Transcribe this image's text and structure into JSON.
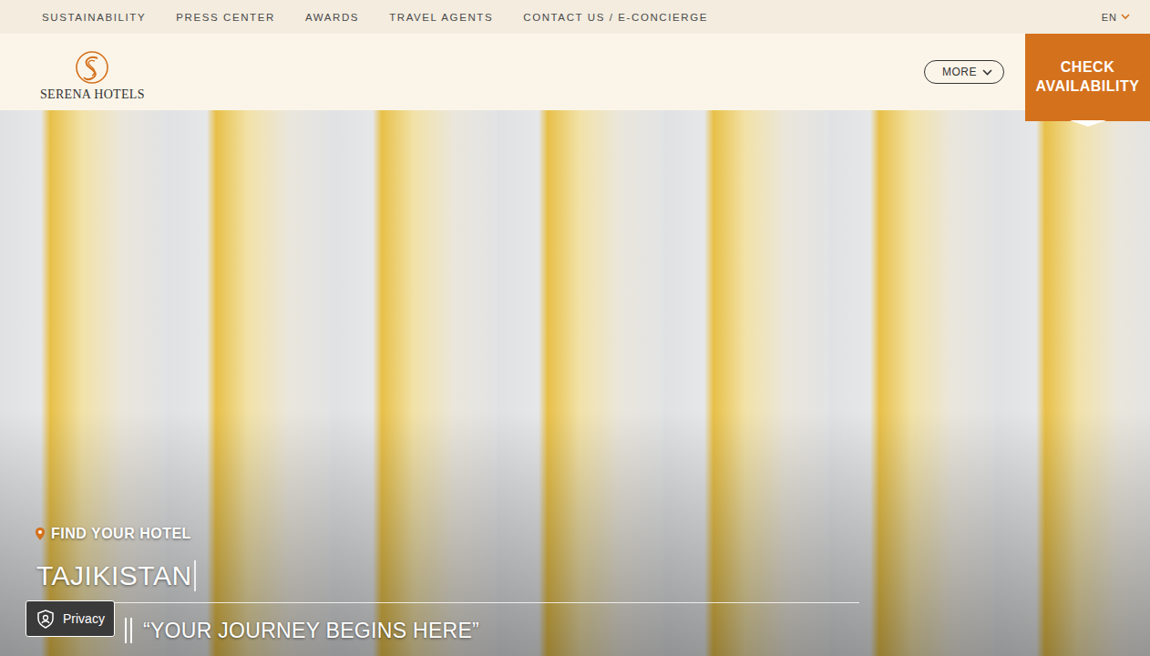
{
  "utility_nav": {
    "links": [
      "SUSTAINABILITY",
      "PRESS CENTER",
      "AWARDS",
      "TRAVEL AGENTS",
      "CONTACT US / E-CONCIERGE"
    ],
    "language": "EN"
  },
  "header": {
    "logo": "SERENA HOTELS",
    "more_button": "MORE",
    "cta": "CHECK AVAILABILITY"
  },
  "hero": {
    "find_label": "FIND YOUR HOTEL",
    "destination": "TAJIKISTAN",
    "tagline": "“YOUR JOURNEY BEGINS HERE”"
  },
  "privacy_button": "Privacy"
}
